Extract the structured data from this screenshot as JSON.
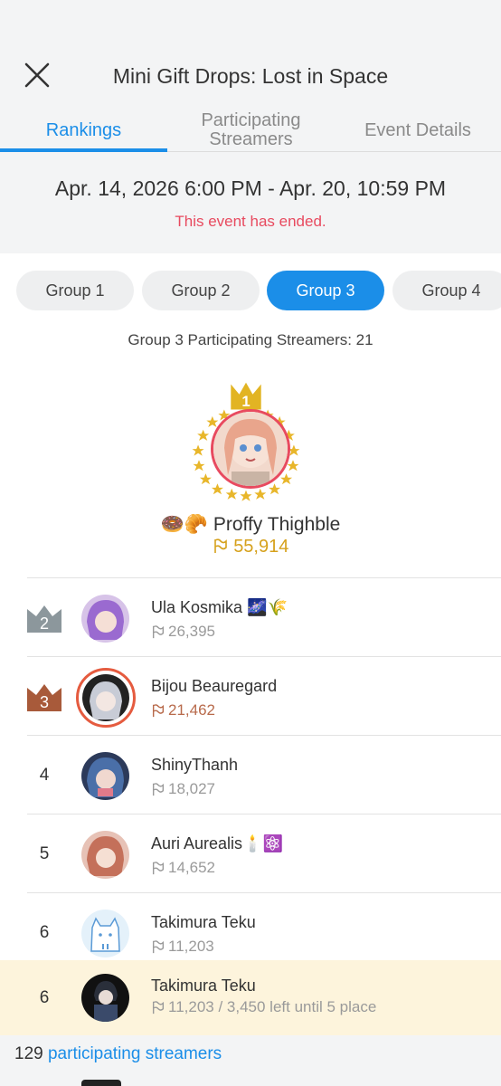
{
  "header": {
    "title": "Mini Gift Drops: Lost in Space",
    "close_icon": "close-icon"
  },
  "tabs": [
    {
      "label": "Rankings",
      "active": true
    },
    {
      "label": "Participating Streamers",
      "active": false
    },
    {
      "label": "Event Details",
      "active": false
    }
  ],
  "event": {
    "date_range": "Apr. 14, 2026 6:00 PM - Apr. 20, 10:59 PM",
    "status": "This event has ended."
  },
  "groups": [
    {
      "label": "Group 1",
      "active": false
    },
    {
      "label": "Group 2",
      "active": false
    },
    {
      "label": "Group 3",
      "active": true
    },
    {
      "label": "Group 4",
      "active": false
    }
  ],
  "group_summary": "Group 3 Participating Streamers: 21",
  "winner": {
    "rank": "1",
    "name": "🍩🥐 Proffy Thighble",
    "score": "55,914"
  },
  "rankings": [
    {
      "rank": "2",
      "name": "Ula Kosmika 🌌🌾",
      "score": "26,395"
    },
    {
      "rank": "3",
      "name": "Bijou Beauregard",
      "score": "21,462"
    },
    {
      "rank": "4",
      "name": "ShinyThanh",
      "score": "18,027"
    },
    {
      "rank": "5",
      "name": "Auri Aurealis🕯️⚛️",
      "score": "14,652"
    },
    {
      "rank": "6",
      "name": "Takimura Teku",
      "score": "11,203"
    }
  ],
  "my_row": {
    "rank": "6",
    "name": "Takimura Teku",
    "score": "11,203 / 3,450 left until 5 place"
  },
  "footer": {
    "count": "129",
    "link_label": "participating streamers"
  },
  "colors": {
    "accent": "#1b8ee8",
    "gold": "#d6a11c",
    "silver": "#8c979c",
    "bronze": "#a85a3a",
    "ended": "#e84a5f",
    "highlight": "#fdf4dc"
  }
}
